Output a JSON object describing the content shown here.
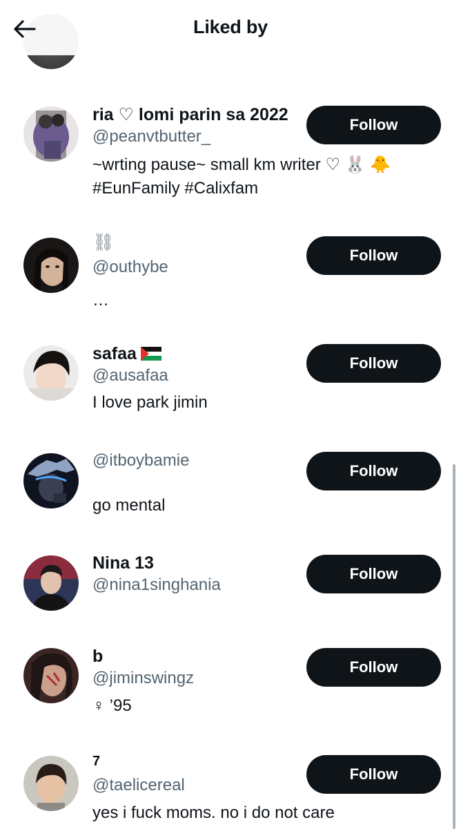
{
  "header": {
    "title": "Liked by",
    "back_icon": "arrow-left-icon"
  },
  "users": [
    {
      "name": "ria ♡ lomi parin sa 2022",
      "handle": "@peanvtbutter_",
      "bio_line1": "~wrting pause~ small km writer ♡ 🐰 🐥",
      "bio_line2": "#EunFamily #Calixfam",
      "follow_label": "Follow"
    },
    {
      "name": "⛓",
      "handle": "@outhybe",
      "bio": "…",
      "follow_label": "Follow"
    },
    {
      "name": "safaa",
      "handle": "@ausafaa",
      "bio": "I love park jimin",
      "follow_label": "Follow"
    },
    {
      "name": "",
      "handle": "@itboybamie",
      "bio": "go mental",
      "follow_label": "Follow"
    },
    {
      "name": "Nina 13",
      "handle": "@nina1singhania",
      "bio": "",
      "follow_label": "Follow"
    },
    {
      "name": "b",
      "handle": "@jiminswingz",
      "bio": "♀ ’95",
      "follow_label": "Follow"
    },
    {
      "name": "7",
      "handle": "@taelicereal",
      "bio": "yes i fuck moms. no i do not care",
      "follow_label": "Follow"
    }
  ],
  "colors": {
    "button_bg": "#0f1419",
    "handle_gray": "#536471",
    "text": "#0f1419"
  }
}
